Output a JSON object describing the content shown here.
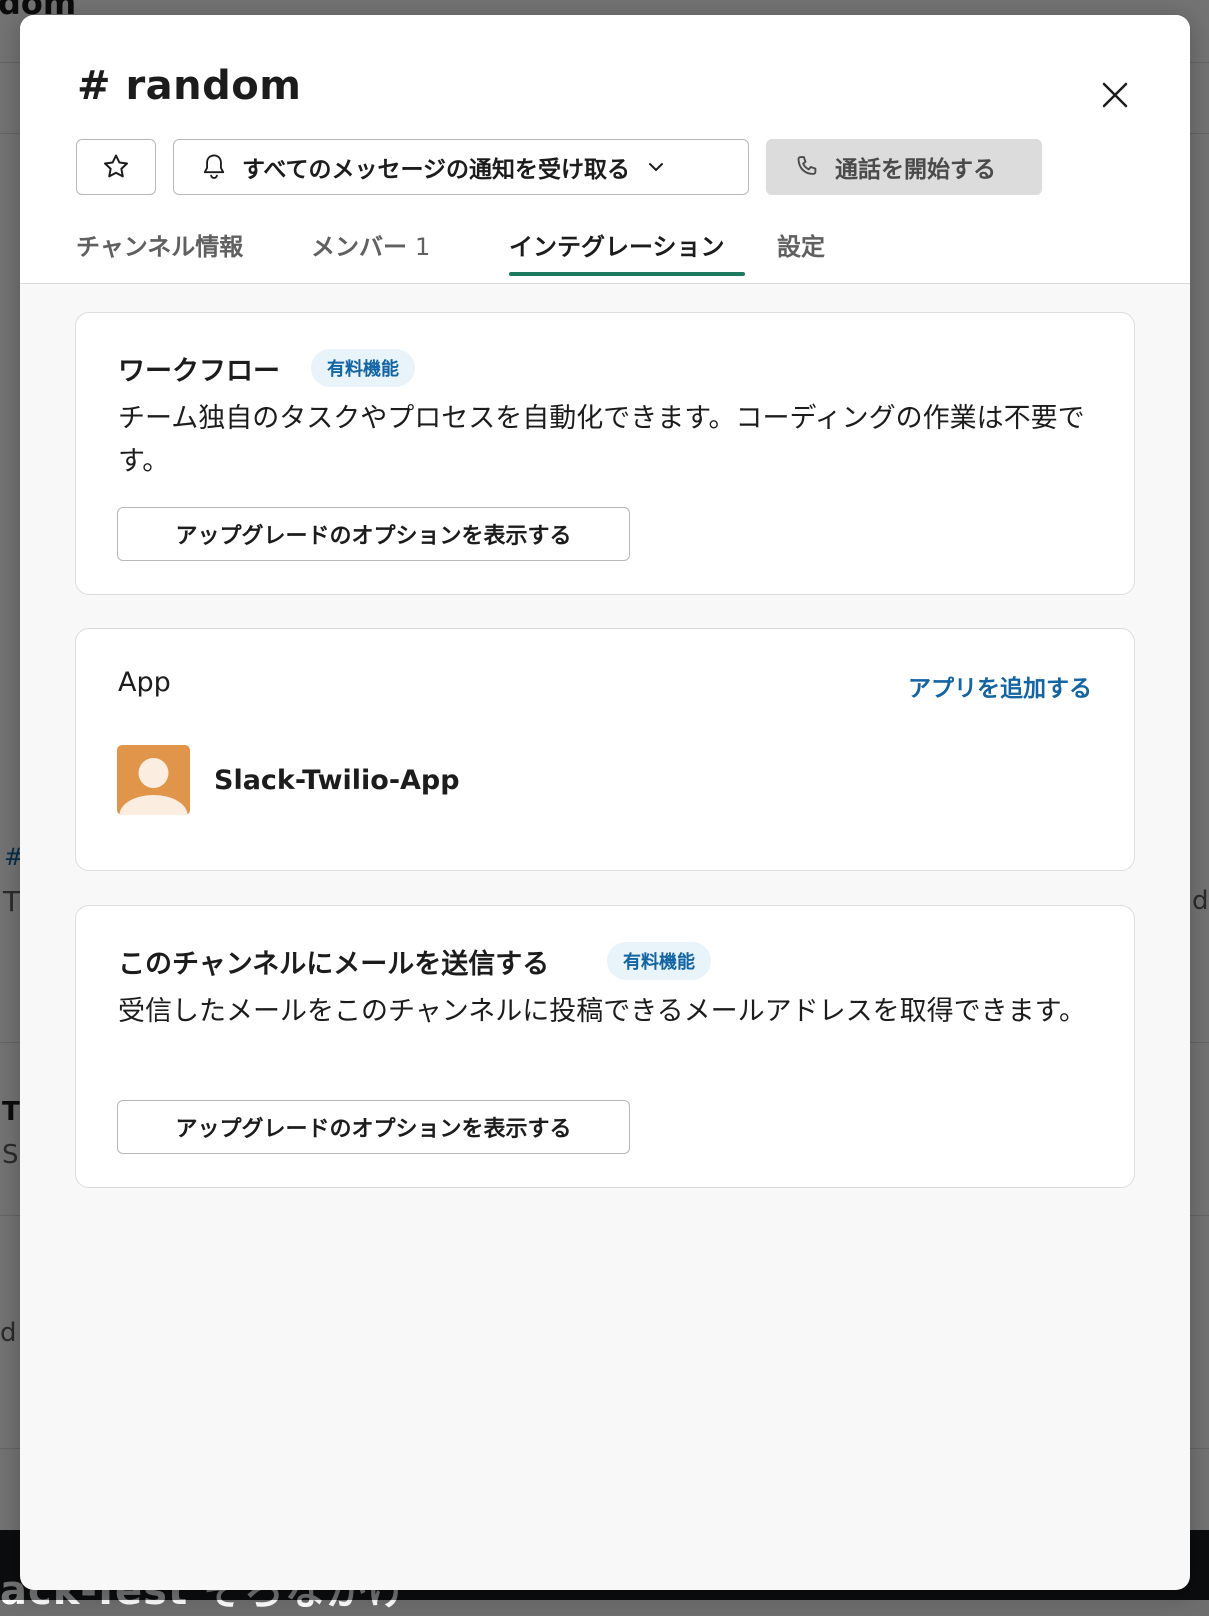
{
  "background": {
    "fragments": [
      "dom",
      "#",
      "T",
      "T",
      "S",
      "d",
      "d",
      "ack-Test そろなかけ"
    ]
  },
  "modal": {
    "title": "# random",
    "notify_label": "すべてのメッセージの通知を受け取る",
    "call_label": "通話を開始する",
    "tabs": [
      {
        "label": "チャンネル情報",
        "count": ""
      },
      {
        "label": "メンバー",
        "count": "1"
      },
      {
        "label": "インテグレーション",
        "count": ""
      },
      {
        "label": "設定",
        "count": ""
      }
    ],
    "active_tab": "インテグレーション"
  },
  "workflow": {
    "title": "ワークフロー",
    "badge": "有料機能",
    "description": "チーム独自のタスクやプロセスを自動化できます。コーディングの作業は不要です。",
    "button": "アップグレードのオプションを表示する"
  },
  "apps": {
    "title": "App",
    "add_link": "アプリを追加する",
    "items": [
      {
        "name": "Slack-Twilio-App"
      }
    ]
  },
  "email": {
    "title": "このチャンネルにメールを送信する",
    "badge": "有料機能",
    "description": "受信したメールをこのチャンネルに投稿できるメールアドレスを取得できます。",
    "button": "アップグレードのオプションを表示する"
  },
  "colors": {
    "accent_tab": "#1d7a5f",
    "link": "#1264a3",
    "badge_bg": "#e8f3fa",
    "avatar": "#e0954a"
  }
}
